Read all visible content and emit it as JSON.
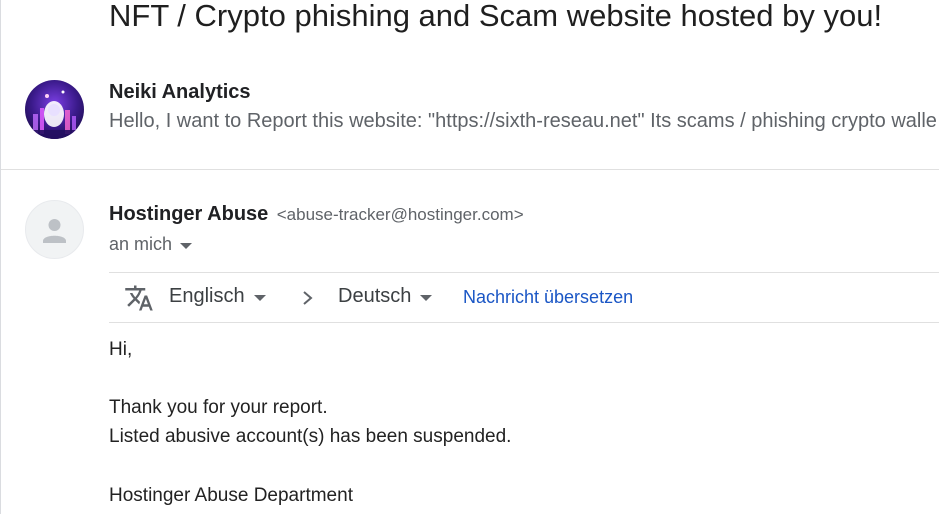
{
  "thread": {
    "subject": "NFT / Crypto phishing and Scam website hosted by you!"
  },
  "messages": [
    {
      "sender_name": "Neiki Analytics",
      "snippet": "Hello, I want to Report this website: \"https://sixth-reseau.net\" Its scams / phishing crypto walle"
    },
    {
      "sender_name": "Hostinger Abuse",
      "sender_email": "<abuse-tracker@hostinger.com>",
      "recipient": "an mich"
    }
  ],
  "translation_bar": {
    "source_language": "Englisch",
    "target_language": "Deutsch",
    "translate_link": "Nachricht übersetzen"
  },
  "body": {
    "greeting": "Hi,",
    "line1": "Thank you for your report.",
    "line2": "Listed abusive account(s) has been suspended.",
    "signature": "Hostinger Abuse Department"
  },
  "colors": {
    "link": "#1a56c5",
    "muted": "#5f6368",
    "divider": "#e0e0e0",
    "avatar_bg": "#f1f3f4"
  },
  "icons": {
    "translate": "translate-icon",
    "chevron": "chevron-right-icon",
    "caret": "caret-down-icon",
    "default_avatar": "person-icon"
  }
}
